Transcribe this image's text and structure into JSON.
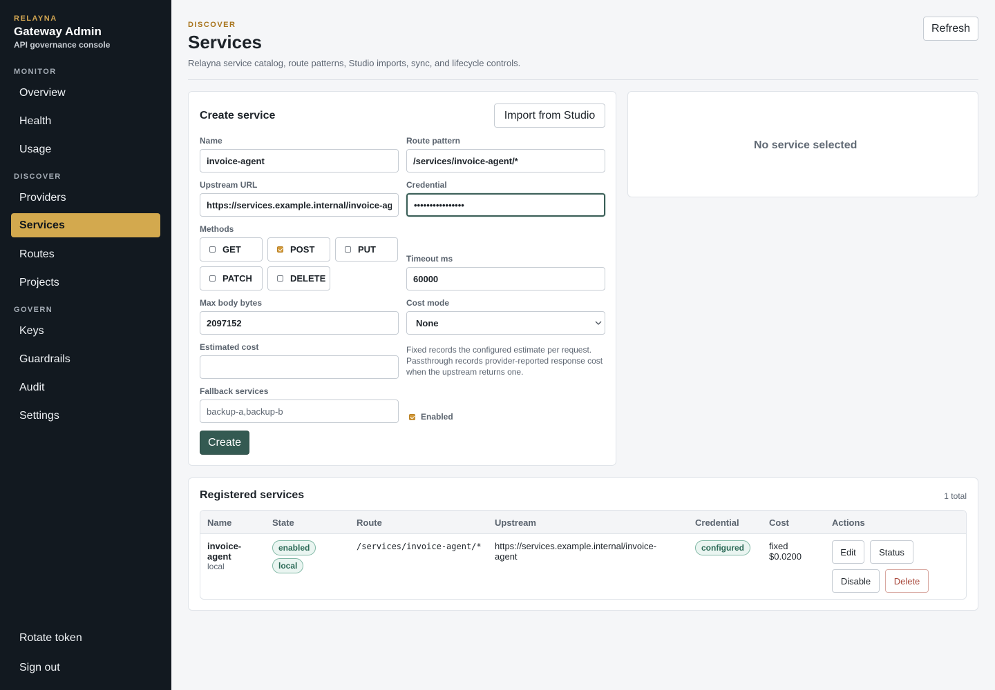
{
  "brand": {
    "kicker": "RELAYNA",
    "title": "Gateway Admin",
    "subtitle": "API governance console"
  },
  "nav": {
    "monitor_label": "MONITOR",
    "discover_label": "DISCOVER",
    "govern_label": "GOVERN",
    "items": {
      "overview": "Overview",
      "health": "Health",
      "usage": "Usage",
      "providers": "Providers",
      "services": "Services",
      "routes": "Routes",
      "projects": "Projects",
      "keys": "Keys",
      "guardrails": "Guardrails",
      "audit": "Audit",
      "settings": "Settings"
    },
    "active": "services",
    "rotate_token": "Rotate token",
    "sign_out": "Sign out"
  },
  "header": {
    "kicker": "DISCOVER",
    "title": "Services",
    "description": "Relayna service catalog, route patterns, Studio imports, sync, and lifecycle controls.",
    "refresh_label": "Refresh"
  },
  "create_form": {
    "title": "Create service",
    "import_label": "Import from Studio",
    "name_label": "Name",
    "name_value": "invoice-agent",
    "route_label": "Route pattern",
    "route_value": "/services/invoice-agent/*",
    "upstream_label": "Upstream URL",
    "upstream_value": "https://services.example.internal/invoice-ag",
    "credential_label": "Credential",
    "credential_value": "••••••••••••••••",
    "methods_label": "Methods",
    "methods": [
      {
        "label": "GET",
        "checked": false
      },
      {
        "label": "POST",
        "checked": true
      },
      {
        "label": "PUT",
        "checked": false
      },
      {
        "label": "PATCH",
        "checked": false
      },
      {
        "label": "DELETE",
        "checked": false
      }
    ],
    "timeout_label": "Timeout ms",
    "timeout_value": "60000",
    "max_body_label": "Max body bytes",
    "max_body_value": "2097152",
    "cost_mode_label": "Cost mode",
    "cost_mode_value": "None",
    "estimated_cost_label": "Estimated cost",
    "estimated_cost_value": "",
    "cost_help": "Fixed records the configured estimate per request. Passthrough records provider-reported response cost when the upstream returns one.",
    "fallback_label": "Fallback services",
    "fallback_placeholder": "backup-a,backup-b",
    "enabled_label": "Enabled",
    "enabled_checked": true,
    "create_label": "Create"
  },
  "detail_panel": {
    "empty_text": "No service selected"
  },
  "registered": {
    "title": "Registered services",
    "count_text": "1 total",
    "columns": {
      "name": "Name",
      "state": "State",
      "route": "Route",
      "upstream": "Upstream",
      "credential": "Credential",
      "cost": "Cost",
      "actions": "Actions"
    },
    "rows": [
      {
        "name_line1": "invoice-",
        "name_line2": "agent",
        "source": "local",
        "state_badges": [
          "enabled",
          "local"
        ],
        "route": "/services/invoice-agent/*",
        "upstream_line1": "https://services.example.internal/invoice-",
        "upstream_line2": "agent",
        "credential_badge": "configured",
        "cost_line1": "fixed",
        "cost_line2": "$0.0200",
        "actions": {
          "edit": "Edit",
          "status": "Status",
          "disable": "Disable",
          "delete": "Delete"
        }
      }
    ]
  },
  "colors": {
    "sidebar_bg": "#121920",
    "accent_gold": "#d3a94e",
    "primary_green": "#345a52",
    "badge_green": "#2c6a57",
    "danger": "#a8473a"
  }
}
